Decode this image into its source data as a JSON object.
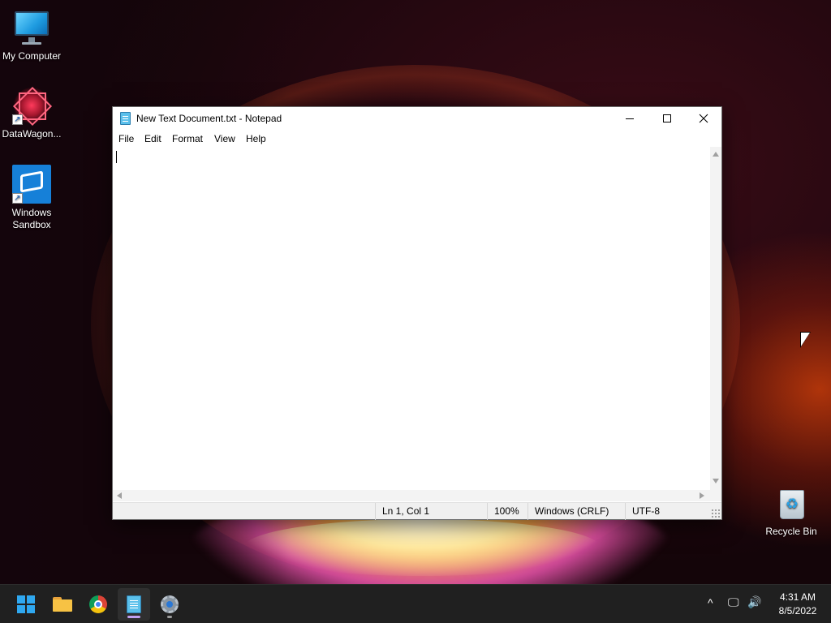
{
  "desktop": {
    "icons": [
      {
        "label": "My Computer"
      },
      {
        "label": "DataWagon..."
      },
      {
        "label": "Windows Sandbox"
      },
      {
        "label": "Recycle Bin"
      }
    ]
  },
  "notepad": {
    "title": "New Text Document.txt - Notepad",
    "menu": [
      "File",
      "Edit",
      "Format",
      "View",
      "Help"
    ],
    "content": "",
    "status": {
      "position": "Ln 1, Col 1",
      "zoom": "100%",
      "line_endings": "Windows (CRLF)",
      "encoding": "UTF-8"
    }
  },
  "taskbar": {
    "apps": [
      {
        "icon": "windows-start-icon"
      },
      {
        "icon": "file-explorer-icon"
      },
      {
        "icon": "chrome-icon"
      },
      {
        "icon": "notepad-icon",
        "active": true
      },
      {
        "icon": "settings-icon"
      }
    ],
    "clock": {
      "time": "4:31 AM",
      "date": "8/5/2022"
    },
    "tray": {
      "chevron_glyph": "^",
      "network_glyph": "🖵",
      "volume_glyph": "🔊"
    }
  },
  "colors": {
    "accent": "#2fa8f0",
    "taskbar_bg": "#202020",
    "active_indicator": "#c1a0f0"
  }
}
